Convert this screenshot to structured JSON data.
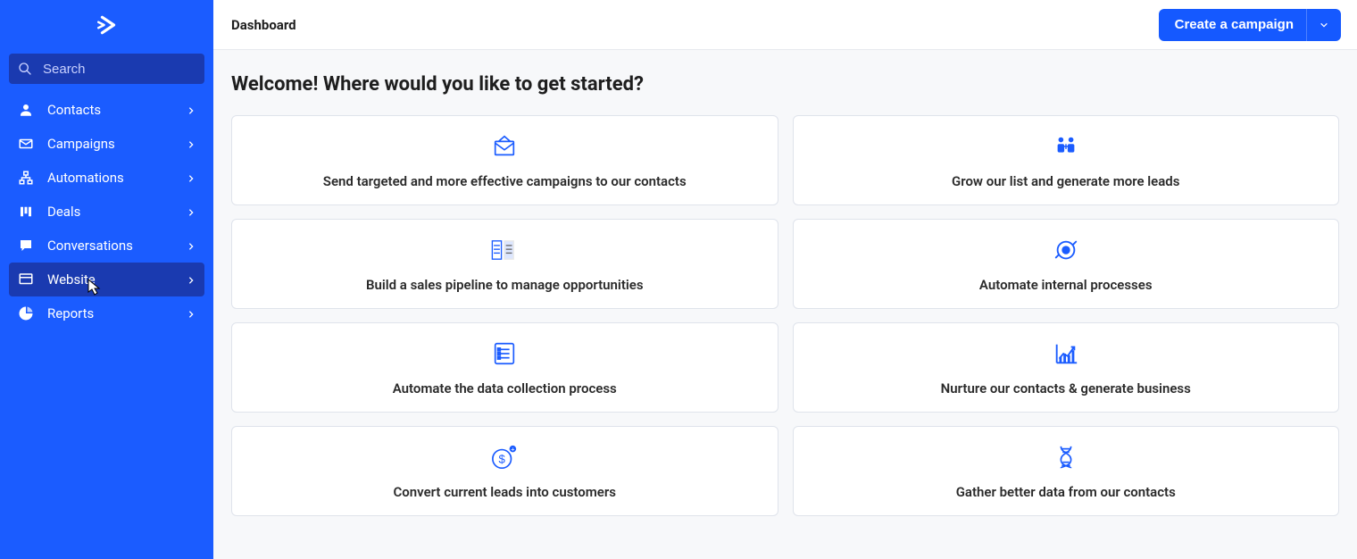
{
  "sidebar": {
    "search_placeholder": "Search",
    "items": [
      {
        "label": "Contacts",
        "icon": "person"
      },
      {
        "label": "Campaigns",
        "icon": "mail"
      },
      {
        "label": "Automations",
        "icon": "hierarchy"
      },
      {
        "label": "Deals",
        "icon": "bars"
      },
      {
        "label": "Conversations",
        "icon": "chat"
      },
      {
        "label": "Website",
        "icon": "site",
        "active": true
      },
      {
        "label": "Reports",
        "icon": "pie"
      }
    ]
  },
  "header": {
    "title": "Dashboard",
    "create_button": "Create a campaign"
  },
  "welcome_heading": "Welcome! Where would you like to get started?",
  "cards": [
    {
      "label": "Send targeted and more effective campaigns to our contacts",
      "icon": "envelope"
    },
    {
      "label": "Grow our list and generate more leads",
      "icon": "people"
    },
    {
      "label": "Build a sales pipeline to manage opportunities",
      "icon": "pipeline"
    },
    {
      "label": "Automate internal processes",
      "icon": "gear"
    },
    {
      "label": "Automate the data collection process",
      "icon": "form"
    },
    {
      "label": "Nurture our contacts & generate business",
      "icon": "chart"
    },
    {
      "label": "Convert current leads into customers",
      "icon": "dollar"
    },
    {
      "label": "Gather better data from our contacts",
      "icon": "dna"
    }
  ]
}
